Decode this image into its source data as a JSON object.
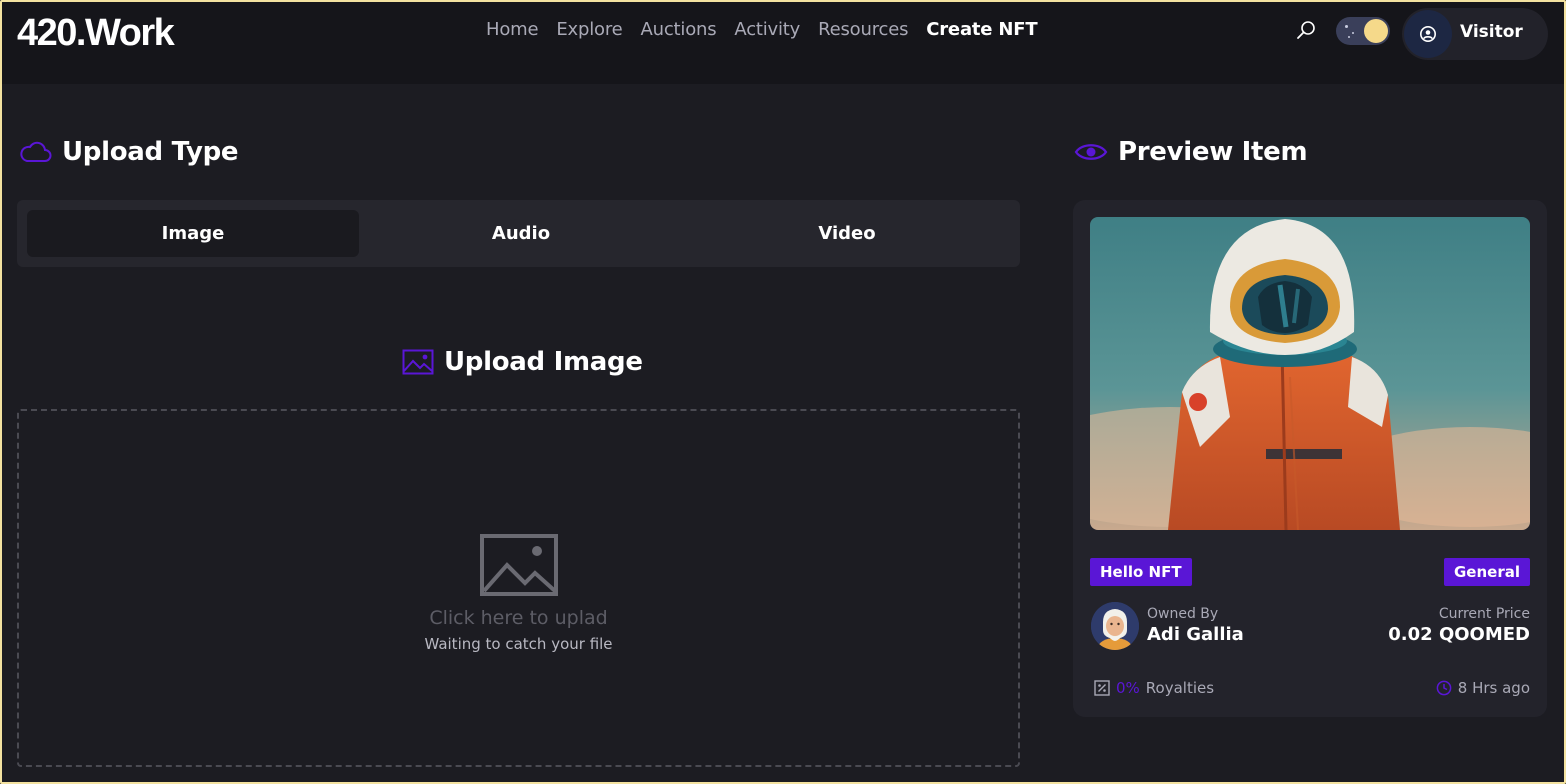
{
  "header": {
    "logo": "420.Work",
    "nav": [
      "Home",
      "Explore",
      "Auctions",
      "Activity",
      "Resources",
      "Create NFT"
    ],
    "active_nav": "Create NFT",
    "user_label": "Visitor"
  },
  "upload": {
    "title": "Upload Type",
    "tabs": [
      "Image",
      "Audio",
      "Video"
    ],
    "active_tab": "Image",
    "section_title": "Upload Image",
    "dropzone_main": "Click here to uplad",
    "dropzone_sub": "Waiting to catch your file"
  },
  "preview": {
    "title": "Preview Item",
    "tag_left": "Hello NFT",
    "tag_right": "General",
    "owner_label": "Owned By",
    "owner_name": "Adi Gallia",
    "price_label": "Current Price",
    "price_value": "0.02 QOOMED",
    "royalty_pct": "0%",
    "royalty_label": "Royalties",
    "time_ago": "8 Hrs ago"
  },
  "colors": {
    "accent": "#5a16d6",
    "background": "#1c1c22",
    "header": "#15151a",
    "card": "#23232b"
  },
  "icons": {
    "search": "search-icon",
    "theme": "moon-toggle",
    "user": "user-circle-icon",
    "cloud": "cloud-icon",
    "eye": "eye-icon",
    "image": "image-icon",
    "percent": "percent-icon",
    "clock": "clock-icon"
  }
}
